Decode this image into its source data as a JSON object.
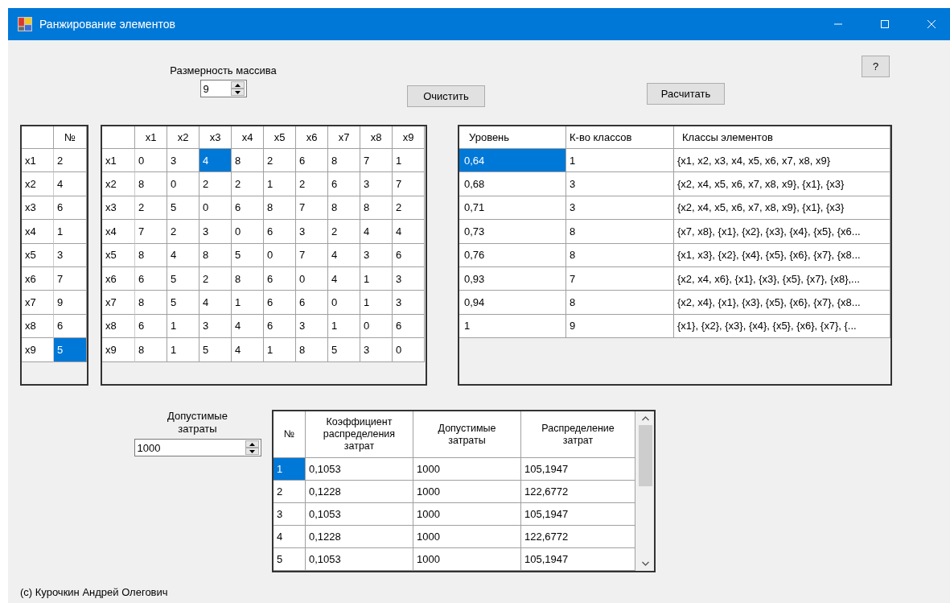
{
  "window": {
    "title": "Ранжирование элементов"
  },
  "help_button": "?",
  "array_size": {
    "label": "Размерность массива",
    "value": "9"
  },
  "clear_button": "Очистить",
  "calc_button": "Расчитать",
  "ranks": {
    "columns": [
      "№"
    ],
    "rows": [
      {
        "header": "x1",
        "cells": [
          {
            "text": "2",
            "selected": false
          }
        ]
      },
      {
        "header": "x2",
        "cells": [
          {
            "text": "4",
            "selected": false
          }
        ]
      },
      {
        "header": "x3",
        "cells": [
          {
            "text": "6",
            "selected": false
          }
        ]
      },
      {
        "header": "x4",
        "cells": [
          {
            "text": "1",
            "selected": false
          }
        ]
      },
      {
        "header": "x5",
        "cells": [
          {
            "text": "3",
            "selected": false
          }
        ]
      },
      {
        "header": "x6",
        "cells": [
          {
            "text": "7",
            "selected": false
          }
        ]
      },
      {
        "header": "x7",
        "cells": [
          {
            "text": "9",
            "selected": false
          }
        ]
      },
      {
        "header": "x8",
        "cells": [
          {
            "text": "6",
            "selected": false
          }
        ]
      },
      {
        "header": "x9",
        "cells": [
          {
            "text": "5",
            "selected": true
          }
        ]
      }
    ]
  },
  "matrix": {
    "columns": [
      "x1",
      "x2",
      "x3",
      "x4",
      "x5",
      "x6",
      "x7",
      "x8",
      "x9"
    ],
    "rows": [
      {
        "header": "x1",
        "cells": [
          {
            "text": "0",
            "selected": false
          },
          {
            "text": "3",
            "selected": false
          },
          {
            "text": "4",
            "selected": true
          },
          {
            "text": "8",
            "selected": false
          },
          {
            "text": "2",
            "selected": false
          },
          {
            "text": "6",
            "selected": false
          },
          {
            "text": "8",
            "selected": false
          },
          {
            "text": "7",
            "selected": false
          },
          {
            "text": "1",
            "selected": false
          }
        ]
      },
      {
        "header": "x2",
        "cells": [
          {
            "text": "8",
            "selected": false
          },
          {
            "text": "0",
            "selected": false
          },
          {
            "text": "2",
            "selected": false
          },
          {
            "text": "2",
            "selected": false
          },
          {
            "text": "1",
            "selected": false
          },
          {
            "text": "2",
            "selected": false
          },
          {
            "text": "6",
            "selected": false
          },
          {
            "text": "3",
            "selected": false
          },
          {
            "text": "7",
            "selected": false
          }
        ]
      },
      {
        "header": "x3",
        "cells": [
          {
            "text": "2",
            "selected": false
          },
          {
            "text": "5",
            "selected": false
          },
          {
            "text": "0",
            "selected": false
          },
          {
            "text": "6",
            "selected": false
          },
          {
            "text": "8",
            "selected": false
          },
          {
            "text": "7",
            "selected": false
          },
          {
            "text": "8",
            "selected": false
          },
          {
            "text": "8",
            "selected": false
          },
          {
            "text": "2",
            "selected": false
          }
        ]
      },
      {
        "header": "x4",
        "cells": [
          {
            "text": "7",
            "selected": false
          },
          {
            "text": "2",
            "selected": false
          },
          {
            "text": "3",
            "selected": false
          },
          {
            "text": "0",
            "selected": false
          },
          {
            "text": "6",
            "selected": false
          },
          {
            "text": "3",
            "selected": false
          },
          {
            "text": "2",
            "selected": false
          },
          {
            "text": "4",
            "selected": false
          },
          {
            "text": "4",
            "selected": false
          }
        ]
      },
      {
        "header": "x5",
        "cells": [
          {
            "text": "8",
            "selected": false
          },
          {
            "text": "4",
            "selected": false
          },
          {
            "text": "8",
            "selected": false
          },
          {
            "text": "5",
            "selected": false
          },
          {
            "text": "0",
            "selected": false
          },
          {
            "text": "7",
            "selected": false
          },
          {
            "text": "4",
            "selected": false
          },
          {
            "text": "3",
            "selected": false
          },
          {
            "text": "6",
            "selected": false
          }
        ]
      },
      {
        "header": "x6",
        "cells": [
          {
            "text": "6",
            "selected": false
          },
          {
            "text": "5",
            "selected": false
          },
          {
            "text": "2",
            "selected": false
          },
          {
            "text": "8",
            "selected": false
          },
          {
            "text": "6",
            "selected": false
          },
          {
            "text": "0",
            "selected": false
          },
          {
            "text": "4",
            "selected": false
          },
          {
            "text": "1",
            "selected": false
          },
          {
            "text": "3",
            "selected": false
          }
        ]
      },
      {
        "header": "x7",
        "cells": [
          {
            "text": "8",
            "selected": false
          },
          {
            "text": "5",
            "selected": false
          },
          {
            "text": "4",
            "selected": false
          },
          {
            "text": "1",
            "selected": false
          },
          {
            "text": "6",
            "selected": false
          },
          {
            "text": "6",
            "selected": false
          },
          {
            "text": "0",
            "selected": false
          },
          {
            "text": "1",
            "selected": false
          },
          {
            "text": "3",
            "selected": false
          }
        ]
      },
      {
        "header": "x8",
        "cells": [
          {
            "text": "6",
            "selected": false
          },
          {
            "text": "1",
            "selected": false
          },
          {
            "text": "3",
            "selected": false
          },
          {
            "text": "4",
            "selected": false
          },
          {
            "text": "6",
            "selected": false
          },
          {
            "text": "3",
            "selected": false
          },
          {
            "text": "1",
            "selected": false
          },
          {
            "text": "0",
            "selected": false
          },
          {
            "text": "6",
            "selected": false
          }
        ]
      },
      {
        "header": "x9",
        "cells": [
          {
            "text": "8",
            "selected": false
          },
          {
            "text": "1",
            "selected": false
          },
          {
            "text": "5",
            "selected": false
          },
          {
            "text": "4",
            "selected": false
          },
          {
            "text": "1",
            "selected": false
          },
          {
            "text": "8",
            "selected": false
          },
          {
            "text": "5",
            "selected": false
          },
          {
            "text": "3",
            "selected": false
          },
          {
            "text": "0",
            "selected": false
          }
        ]
      }
    ]
  },
  "levels": {
    "columns": [
      "Уровень",
      "К-во классов",
      "Классы элементов"
    ],
    "rows": [
      {
        "cells": [
          {
            "text": "0,64",
            "selected": true
          },
          {
            "text": "1",
            "selected": false
          },
          {
            "text": "{x1, x2, x3, x4, x5, x6, x7, x8, x9}",
            "selected": false
          }
        ]
      },
      {
        "cells": [
          {
            "text": "0,68",
            "selected": false
          },
          {
            "text": "3",
            "selected": false
          },
          {
            "text": "{x2, x4, x5, x6, x7, x8, x9}, {x1}, {x3}",
            "selected": false
          }
        ]
      },
      {
        "cells": [
          {
            "text": "0,71",
            "selected": false
          },
          {
            "text": "3",
            "selected": false
          },
          {
            "text": "{x2, x4, x5, x6, x7, x8, x9}, {x1}, {x3}",
            "selected": false
          }
        ]
      },
      {
        "cells": [
          {
            "text": "0,73",
            "selected": false
          },
          {
            "text": "8",
            "selected": false
          },
          {
            "text": "{x7, x8}, {x1}, {x2}, {x3}, {x4}, {x5}, {x6...",
            "selected": false
          }
        ]
      },
      {
        "cells": [
          {
            "text": "0,76",
            "selected": false
          },
          {
            "text": "8",
            "selected": false
          },
          {
            "text": "{x1, x3}, {x2}, {x4}, {x5}, {x6}, {x7}, {x8...",
            "selected": false
          }
        ]
      },
      {
        "cells": [
          {
            "text": "0,93",
            "selected": false
          },
          {
            "text": "7",
            "selected": false
          },
          {
            "text": "{x2, x4, x6}, {x1}, {x3}, {x5}, {x7}, {x8},...",
            "selected": false
          }
        ]
      },
      {
        "cells": [
          {
            "text": "0,94",
            "selected": false
          },
          {
            "text": "8",
            "selected": false
          },
          {
            "text": "{x2, x4}, {x1}, {x3}, {x5}, {x6}, {x7}, {x8...",
            "selected": false
          }
        ]
      },
      {
        "cells": [
          {
            "text": "1",
            "selected": false
          },
          {
            "text": "9",
            "selected": false
          },
          {
            "text": "{x1}, {x2}, {x3}, {x4}, {x5}, {x6}, {x7}, {...",
            "selected": false
          }
        ]
      }
    ]
  },
  "costs_input": {
    "label": "Допустимые затраты",
    "value": "1000"
  },
  "costs": {
    "columns": [
      "№",
      "Коэффициент распределения затрат",
      "Допустимые затраты",
      "Распределение затрат"
    ],
    "rows": [
      {
        "cells": [
          {
            "text": "1",
            "selected": true
          },
          {
            "text": "0,1053",
            "selected": false
          },
          {
            "text": "1000",
            "selected": false
          },
          {
            "text": "105,1947",
            "selected": false
          }
        ]
      },
      {
        "cells": [
          {
            "text": "2",
            "selected": false
          },
          {
            "text": "0,1228",
            "selected": false
          },
          {
            "text": "1000",
            "selected": false
          },
          {
            "text": "122,6772",
            "selected": false
          }
        ]
      },
      {
        "cells": [
          {
            "text": "3",
            "selected": false
          },
          {
            "text": "0,1053",
            "selected": false
          },
          {
            "text": "1000",
            "selected": false
          },
          {
            "text": "105,1947",
            "selected": false
          }
        ]
      },
      {
        "cells": [
          {
            "text": "4",
            "selected": false
          },
          {
            "text": "0,1228",
            "selected": false
          },
          {
            "text": "1000",
            "selected": false
          },
          {
            "text": "122,6772",
            "selected": false
          }
        ]
      },
      {
        "cells": [
          {
            "text": "5",
            "selected": false
          },
          {
            "text": "0,1053",
            "selected": false
          },
          {
            "text": "1000",
            "selected": false
          },
          {
            "text": "105,1947",
            "selected": false
          }
        ]
      }
    ]
  },
  "footer": "(c) Курочкин Андрей Олегович"
}
